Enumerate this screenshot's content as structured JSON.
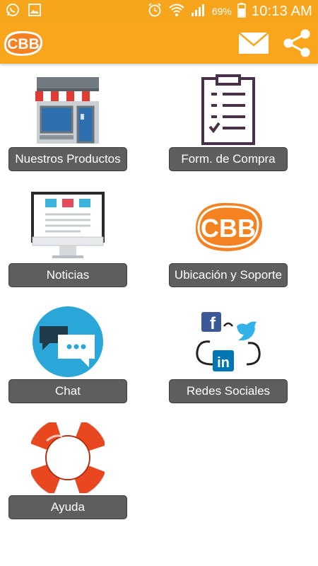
{
  "status_bar": {
    "battery": "69%",
    "time": "10:13 AM",
    "icons": [
      "whatsapp-icon",
      "gallery-icon",
      "alarm-icon",
      "wifi-icon",
      "signal-icon",
      "battery-icon"
    ]
  },
  "app_bar": {
    "logo_text": "CBB",
    "actions": [
      "mail-icon",
      "share-icon"
    ],
    "color": "#f9a61d"
  },
  "menu": {
    "productos": "Nuestros Productos",
    "compra": "Form. de Compra",
    "noticias": "Noticias",
    "ubicacion": "Ubicación y Soporte",
    "chat": "Chat",
    "redes": "Redes Sociales",
    "ayuda": "Ayuda"
  },
  "brand_colors": {
    "orange": "#f58220",
    "label_bg": "#5e5e5e"
  }
}
